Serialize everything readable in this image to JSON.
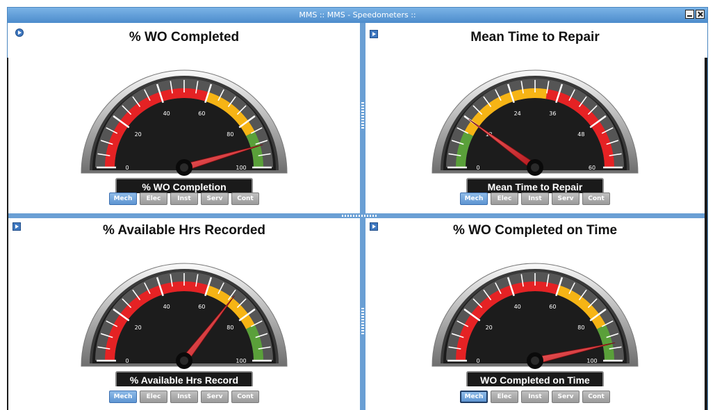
{
  "window": {
    "title": "MMS :: MMS - Speedometers ::"
  },
  "colors": {
    "red": "#e52224",
    "yellow": "#f6b415",
    "green": "#5aa03a",
    "titlebar": "#5b97d2",
    "active_btn": "#6fa3dc"
  },
  "panels": [
    {
      "title": "% WO Completed",
      "gauge_label": "% WO Completion",
      "ticks": [
        "0",
        "20",
        "40",
        "60",
        "80",
        "100"
      ],
      "max": 100,
      "value": 91,
      "bands": [
        {
          "from": 0,
          "to": 60,
          "color": "red"
        },
        {
          "from": 60,
          "to": 85,
          "color": "yellow"
        },
        {
          "from": 85,
          "to": 100,
          "color": "green"
        }
      ],
      "buttons": [
        "Mech",
        "Elec",
        "Inst",
        "Serv",
        "Cont"
      ],
      "active": "Mech",
      "icon": "circle-play-icon"
    },
    {
      "title": "Mean Time to Repair",
      "gauge_label": "Mean Time to Repair",
      "ticks": [
        "0",
        "12",
        "24",
        "36",
        "48",
        "60"
      ],
      "max": 60,
      "value": 12,
      "bands": [
        {
          "from": 0,
          "to": 9,
          "color": "green"
        },
        {
          "from": 9,
          "to": 33,
          "color": "yellow"
        },
        {
          "from": 33,
          "to": 60,
          "color": "red"
        }
      ],
      "buttons": [
        "Mech",
        "Elec",
        "Inst",
        "Serv",
        "Cont"
      ],
      "active": "Mech",
      "icon": "play-square-icon"
    },
    {
      "title": "% Available Hrs Recorded",
      "gauge_label": "% Available Hrs Record",
      "ticks": [
        "0",
        "20",
        "40",
        "60",
        "80",
        "100"
      ],
      "max": 100,
      "value": 71,
      "bands": [
        {
          "from": 0,
          "to": 60,
          "color": "red"
        },
        {
          "from": 60,
          "to": 85,
          "color": "yellow"
        },
        {
          "from": 85,
          "to": 100,
          "color": "green"
        }
      ],
      "buttons": [
        "Mech",
        "Elec",
        "Inst",
        "Serv",
        "Cont"
      ],
      "active": "Mech",
      "icon": "play-square-icon"
    },
    {
      "title": "% WO Completed on Time",
      "gauge_label": "WO Completed on Time",
      "ticks": [
        "0",
        "20",
        "40",
        "60",
        "80",
        "100"
      ],
      "max": 100,
      "value": 93,
      "bands": [
        {
          "from": 0,
          "to": 60,
          "color": "red"
        },
        {
          "from": 60,
          "to": 85,
          "color": "yellow"
        },
        {
          "from": 85,
          "to": 100,
          "color": "green"
        }
      ],
      "buttons": [
        "Mech",
        "Elec",
        "Inst",
        "Serv",
        "Cont"
      ],
      "active": "Mech",
      "icon": "play-square-icon"
    }
  ]
}
